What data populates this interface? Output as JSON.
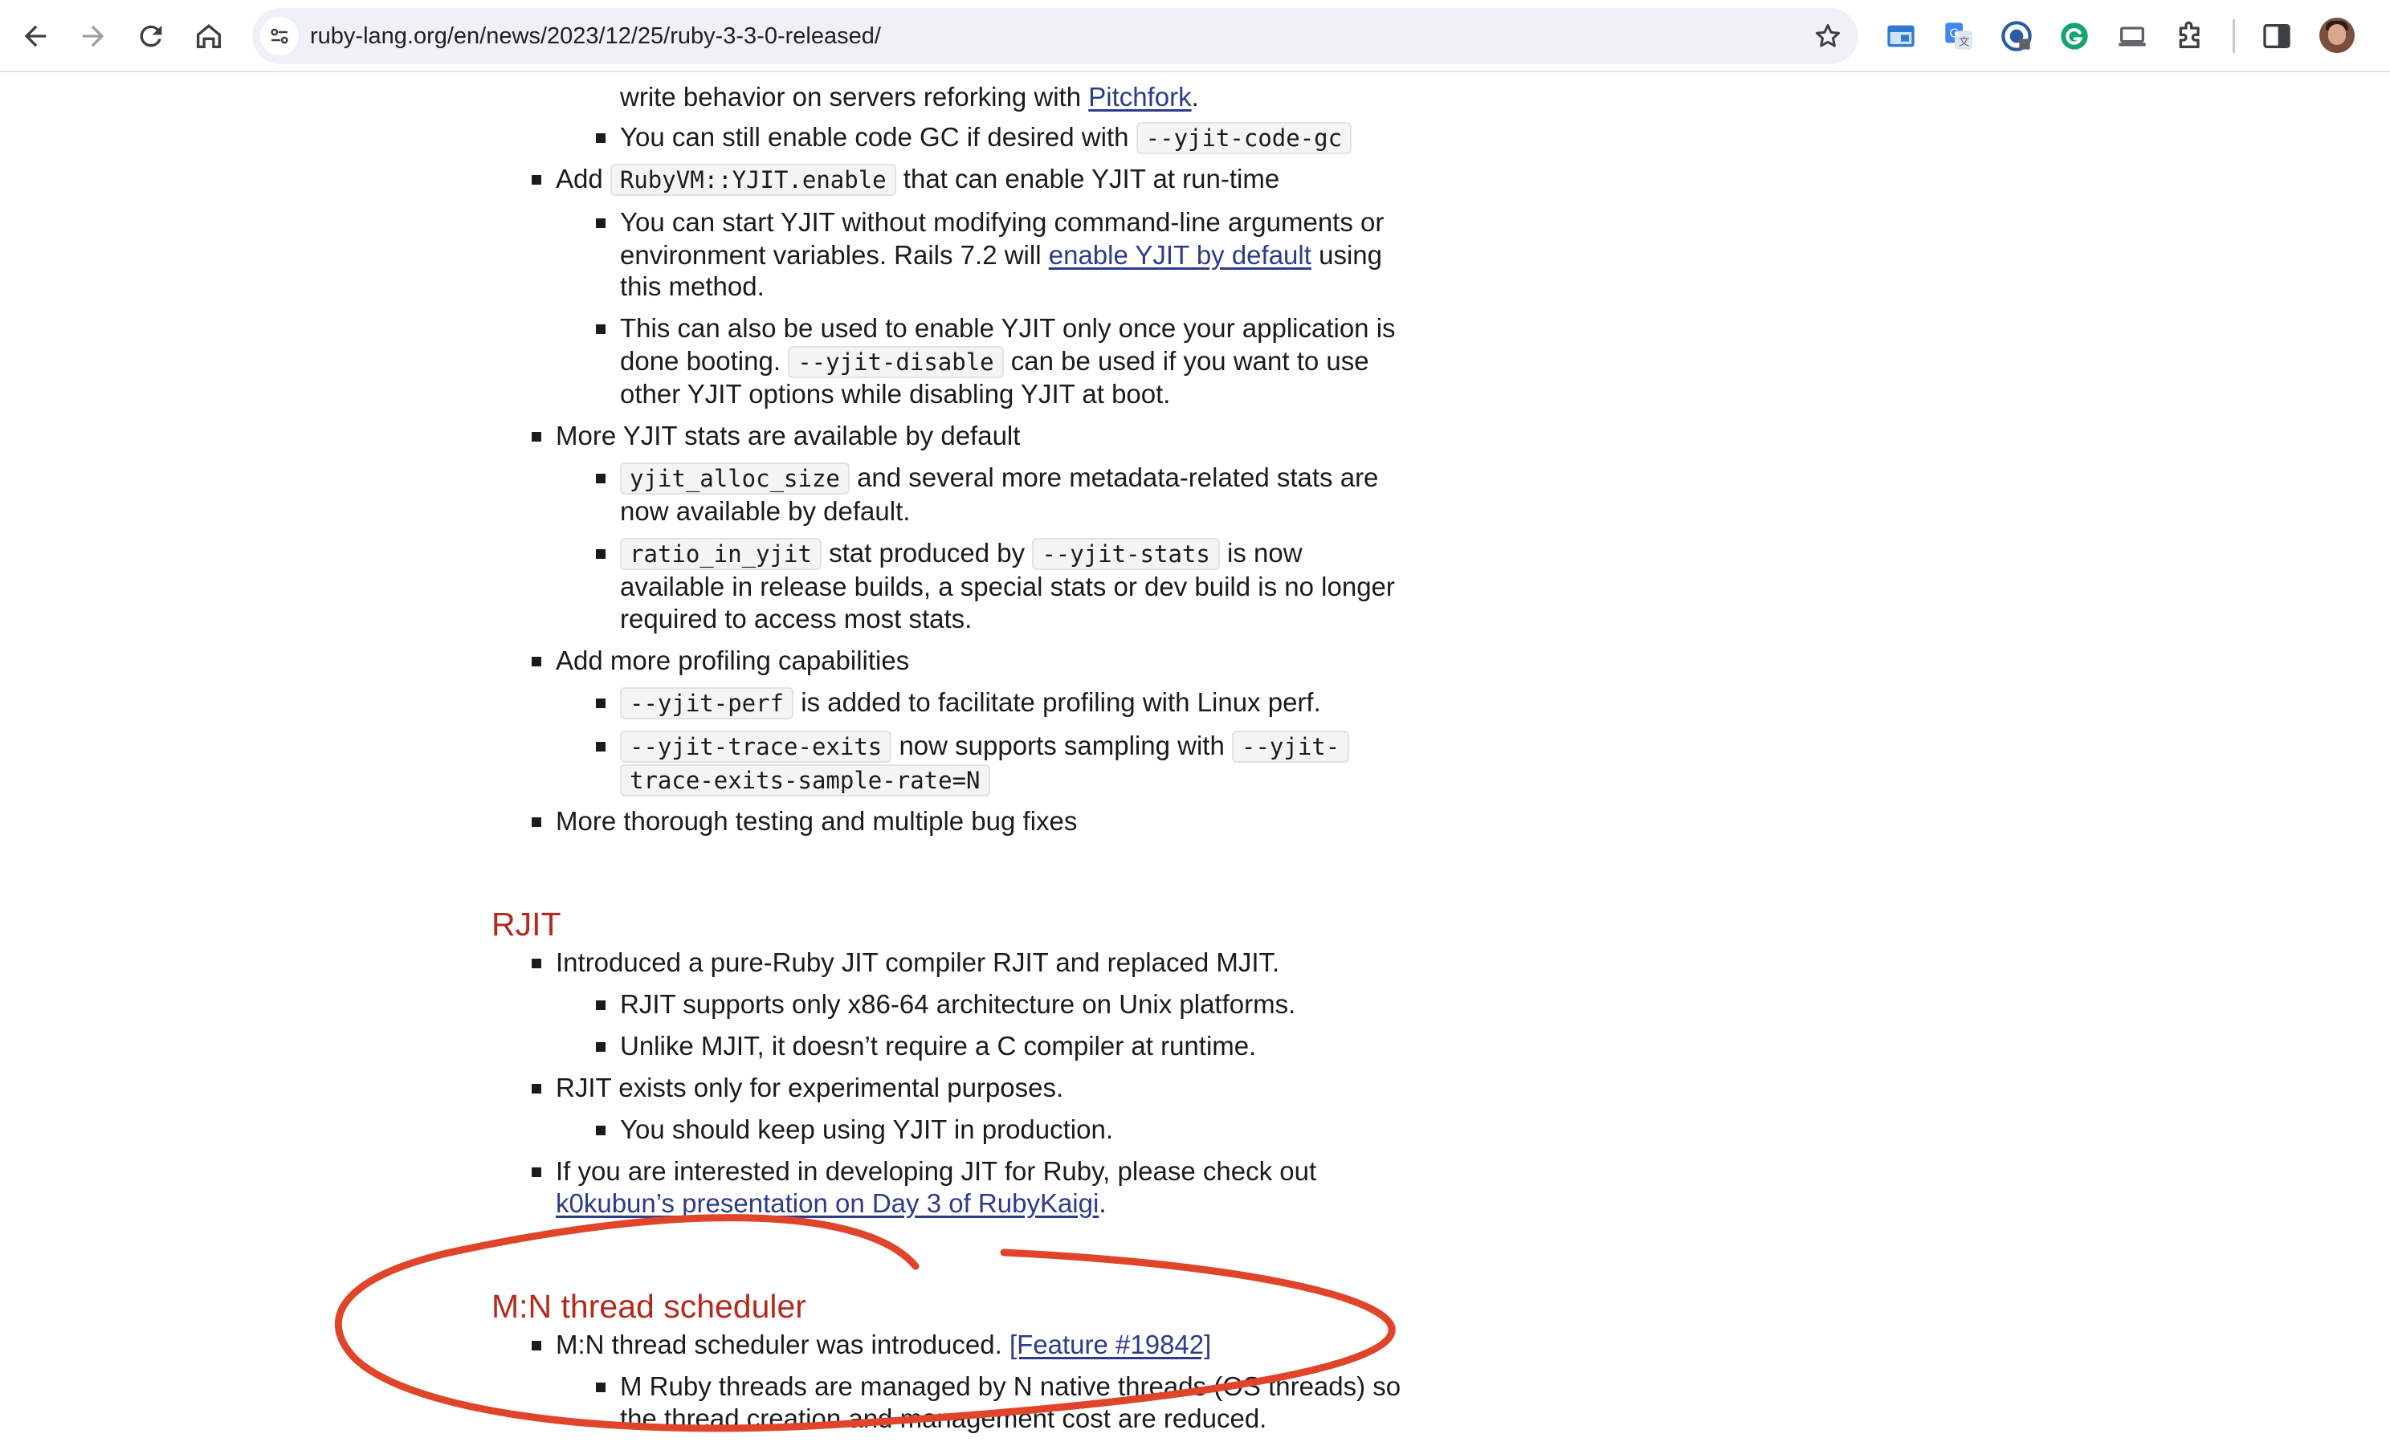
{
  "browser": {
    "url": "ruby-lang.org/en/news/2023/12/25/ruby-3-3-0-released/",
    "icons": [
      "back-icon",
      "forward-icon",
      "reload-icon",
      "home-icon",
      "site-info-icon",
      "bookmark-star-icon",
      "extension-window-icon",
      "google-translate-icon",
      "password-manager-icon",
      "grammarly-icon",
      "cast-icon",
      "puzzle-extensions-icon",
      "side-panel-icon",
      "profile-avatar"
    ]
  },
  "article": {
    "l01": "write behavior on servers reforking with ",
    "l01_link": "Pitchfork",
    "l01_end": ".",
    "l02": "You can still enable code GC if desired with ",
    "l02_code": "--yjit-code-gc",
    "l03_pre": "Add ",
    "l03_code": "RubyVM::YJIT.enable",
    "l03_post": " that can enable YJIT at run-time",
    "l04": "You can start YJIT without modifying command-line arguments or",
    "l05_pre": "environment variables. Rails 7.2 will ",
    "l05_link": "enable YJIT by default",
    "l05_post": " using",
    "l06": "this method.",
    "l07": "This can also be used to enable YJIT only once your application is",
    "l08_pre": "done booting. ",
    "l08_code": "--yjit-disable",
    "l08_post": " can be used if you want to use",
    "l09": "other YJIT options while disabling YJIT at boot.",
    "l10": "More YJIT stats are available by default",
    "l11_code": "yjit_alloc_size",
    "l11_post": " and several more metadata-related stats are",
    "l12": "now available by default.",
    "l13_code": "ratio_in_yjit",
    "l13_mid": " stat produced by ",
    "l13_code2": "--yjit-stats",
    "l13_post": " is now",
    "l14": "available in release builds, a special stats or dev build is no longer",
    "l15": "required to access most stats.",
    "l16": "Add more profiling capabilities",
    "l17_code": "--yjit-perf",
    "l17_post": " is added to facilitate profiling with Linux perf.",
    "l18_code": "--yjit-trace-exits",
    "l18_mid": " now supports sampling with ",
    "l18_code2": "--yjit-",
    "l19_code": "trace-exits-sample-rate=N",
    "l20": "More thorough testing and multiple bug fixes",
    "h_rjit": "RJIT",
    "r1": "Introduced a pure-Ruby JIT compiler RJIT and replaced MJIT.",
    "r2": "RJIT supports only x86-64 architecture on Unix platforms.",
    "r3": "Unlike MJIT, it doesn’t require a C compiler at runtime.",
    "r4": "RJIT exists only for experimental purposes.",
    "r5": "You should keep using YJIT in production.",
    "r6": "If you are interested in developing JIT for Ruby, please check out",
    "r7_link": "k0kubun’s presentation on Day 3 of RubyKaigi",
    "r7_end": ".",
    "h_mn": "M:N thread scheduler",
    "m1": "M:N thread scheduler was introduced. ",
    "m1_link": "[Feature #19842]",
    "m2": "M Ruby threads are managed by N native threads (OS threads) so",
    "m3": "the thread creation and management cost are reduced."
  },
  "colors": {
    "heading": "#b5291e",
    "link": "#2c3b8c",
    "annotation": "#e0452a"
  }
}
